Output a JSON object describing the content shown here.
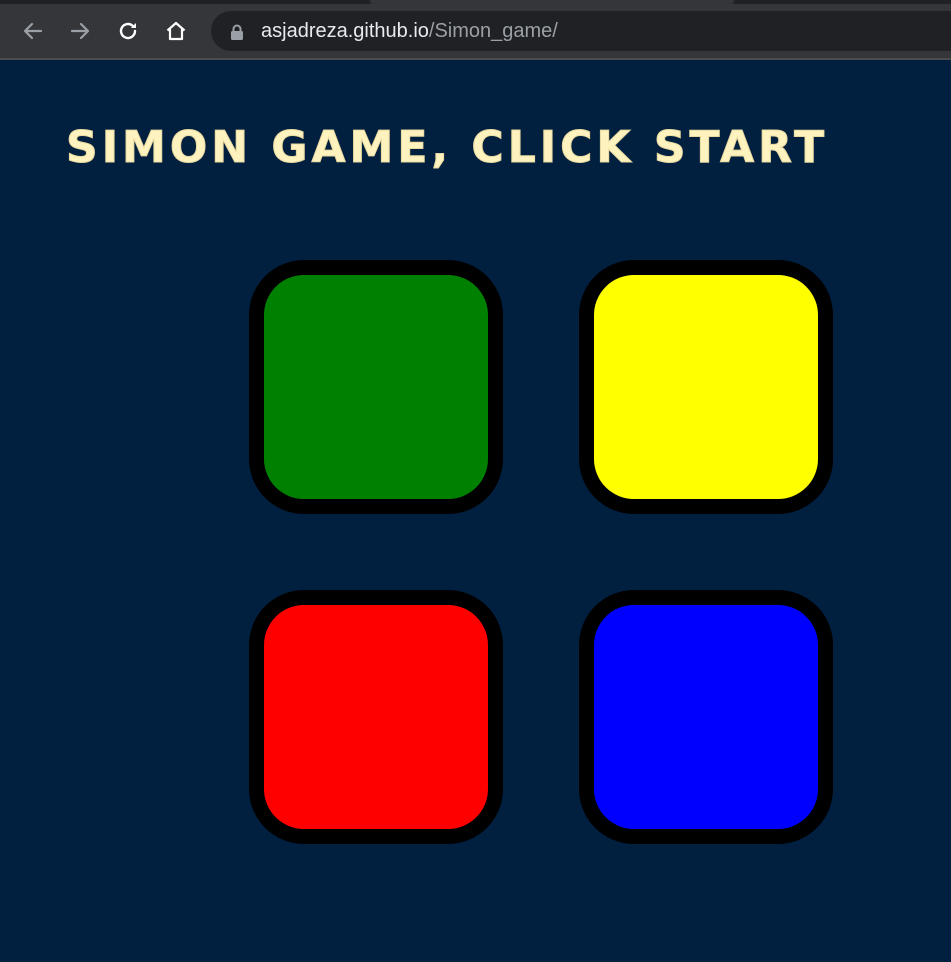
{
  "browser": {
    "url_host": "asjadreza.github.io",
    "url_path": "/Simon_game/",
    "icons": {
      "back": "back-arrow-icon",
      "forward": "forward-arrow-icon",
      "reload": "reload-icon",
      "home": "home-icon",
      "lock": "lock-icon"
    }
  },
  "game": {
    "title": "Simon Game, Click Start",
    "buttons": [
      {
        "id": "green",
        "color": "#008000"
      },
      {
        "id": "yellow",
        "color": "#ffff00"
      },
      {
        "id": "red",
        "color": "#ff0000"
      },
      {
        "id": "blue",
        "color": "#0000ff"
      }
    ]
  },
  "colors": {
    "page_background": "#011f3f",
    "title": "#fef2bf",
    "pad_border": "#000000"
  }
}
